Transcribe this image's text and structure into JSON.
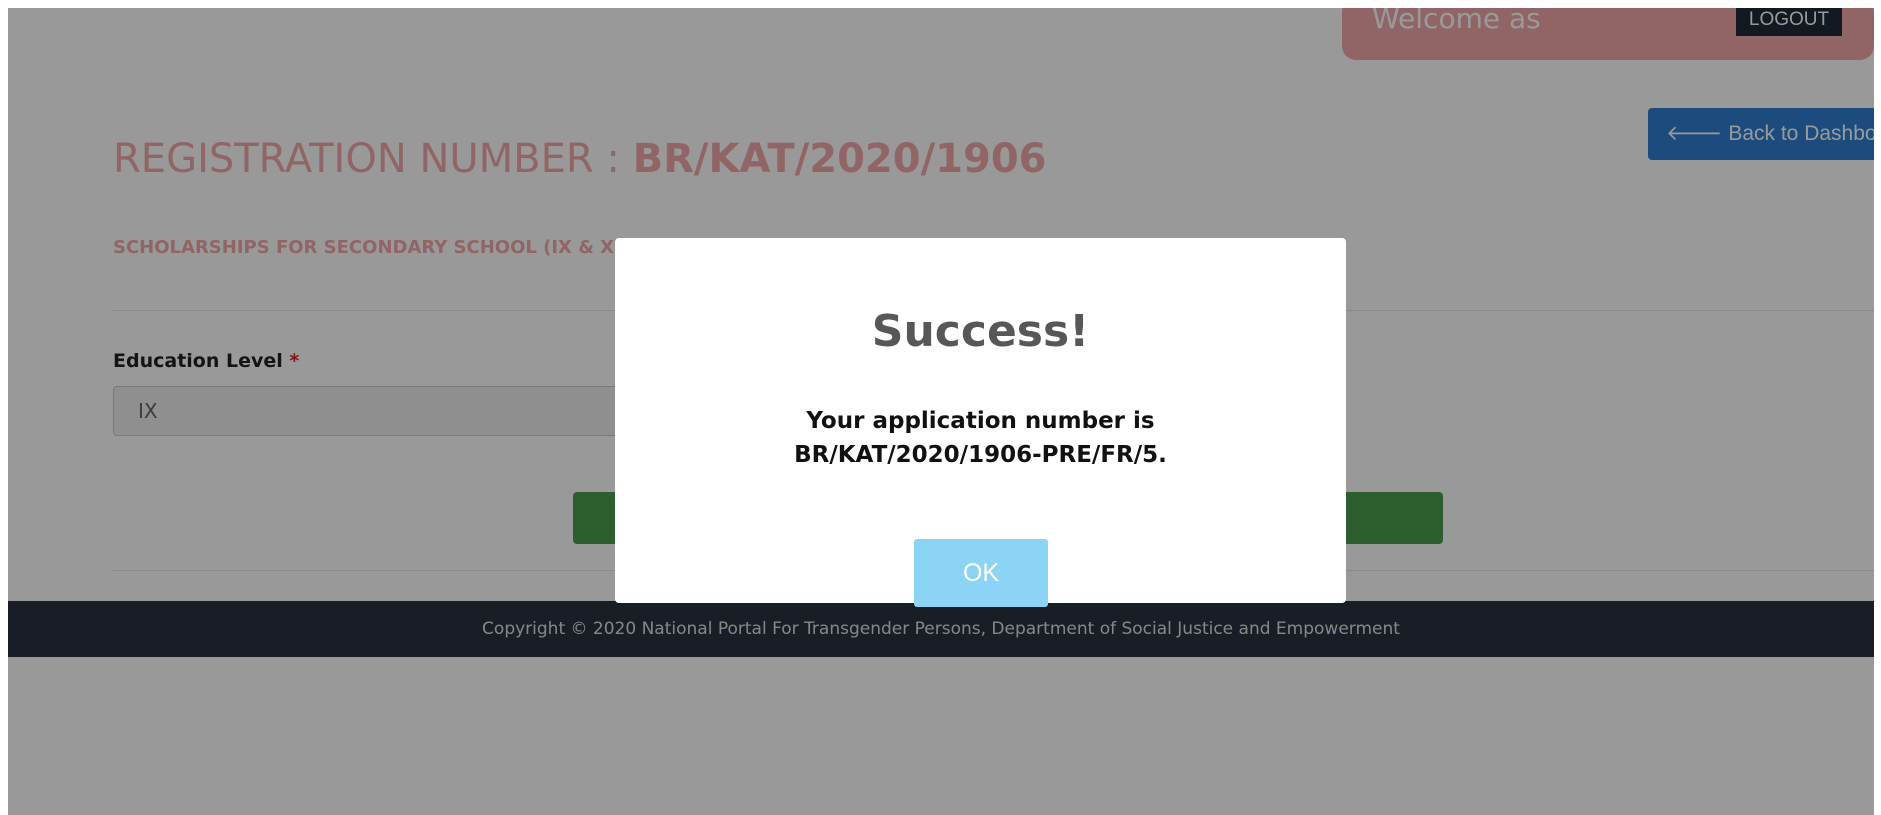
{
  "header": {
    "welcome_text": "Welcome as",
    "logout_label": "LOGOUT",
    "back_label": "Back to Dashboard"
  },
  "page": {
    "reg_prefix": "REGISTRATION NUMBER : ",
    "reg_number": "BR/KAT/2020/1906",
    "scheme_title": "SCHOLARSHIPS FOR SECONDARY SCHOOL (IX & X)",
    "education_level_label": "Education Level",
    "required_mark": "*",
    "education_level_value": "IX"
  },
  "footer": {
    "copyright": "Copyright © 2020 National Portal For Transgender Persons, Department of Social Justice and Empowerment"
  },
  "modal": {
    "title": "Success!",
    "message": "Your application number is BR/KAT/2020/1906-PRE/FR/5.",
    "ok_label": "OK"
  },
  "colors": {
    "accent_pink": "#f2a9a9",
    "back_button": "#2f7fd0",
    "submit_green": "#4a9e4c",
    "footer_dark": "#2a3340",
    "ok_button": "#8cd4f5"
  },
  "icons": {
    "back": "arrow-left-icon"
  }
}
